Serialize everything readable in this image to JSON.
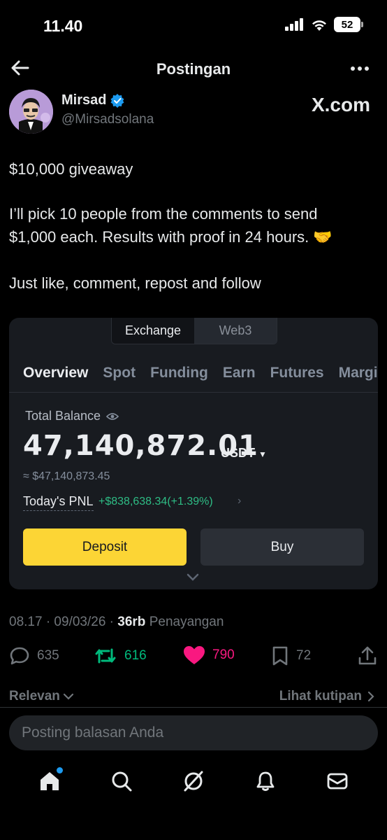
{
  "status_bar": {
    "time": "11.40",
    "battery": "52"
  },
  "header": {
    "title": "Postingan"
  },
  "author": {
    "name": "Mirsad",
    "handle": "@Mirsadsolana",
    "source": "X.com"
  },
  "post": {
    "line1": "$10,000 giveaway",
    "line2a": "I’ll pick 10 people from the comments to send",
    "line2b": "$1,000 each. Results with proof in 24 hours. 🤝",
    "line3": "Just like, comment, repost and follow"
  },
  "embedded": {
    "mode_tabs": [
      "Exchange",
      "Web3"
    ],
    "nav_tabs": [
      "Overview",
      "Spot",
      "Funding",
      "Earn",
      "Futures",
      "Margin"
    ],
    "total_balance_label": "Total Balance",
    "total_balance": "47,140,872.01",
    "unit": "USDT",
    "approx": "≈ $47,140,873.45",
    "pnl_label": "Today's PNL",
    "pnl_value": "+$838,638.34(+1.39%)",
    "deposit_label": "Deposit",
    "buy_label": "Buy"
  },
  "meta": {
    "time": "08.17 · 09/03/26 · ",
    "views": "36rb",
    "views_label": " Penayangan"
  },
  "actions": {
    "replies": "635",
    "reposts": "616",
    "likes": "790",
    "bookmarks": "72"
  },
  "replies": {
    "sort_label": "Relevan",
    "quotes_label": "Lihat kutipan"
  },
  "reply_box": {
    "placeholder": "Posting balasan Anda"
  },
  "colors": {
    "like": "#f91880",
    "repost": "#00ba7c",
    "verified": "#1d9bf0",
    "deposit": "#fcd535",
    "pnl_green": "#2ebd85"
  },
  "icons": [
    "back-arrow-icon",
    "more-icon",
    "verified-badge-icon",
    "reply-icon",
    "repost-icon",
    "heart-icon",
    "bookmark-icon",
    "share-icon",
    "home-icon",
    "search-icon",
    "grok-icon",
    "bell-icon",
    "mail-icon"
  ]
}
